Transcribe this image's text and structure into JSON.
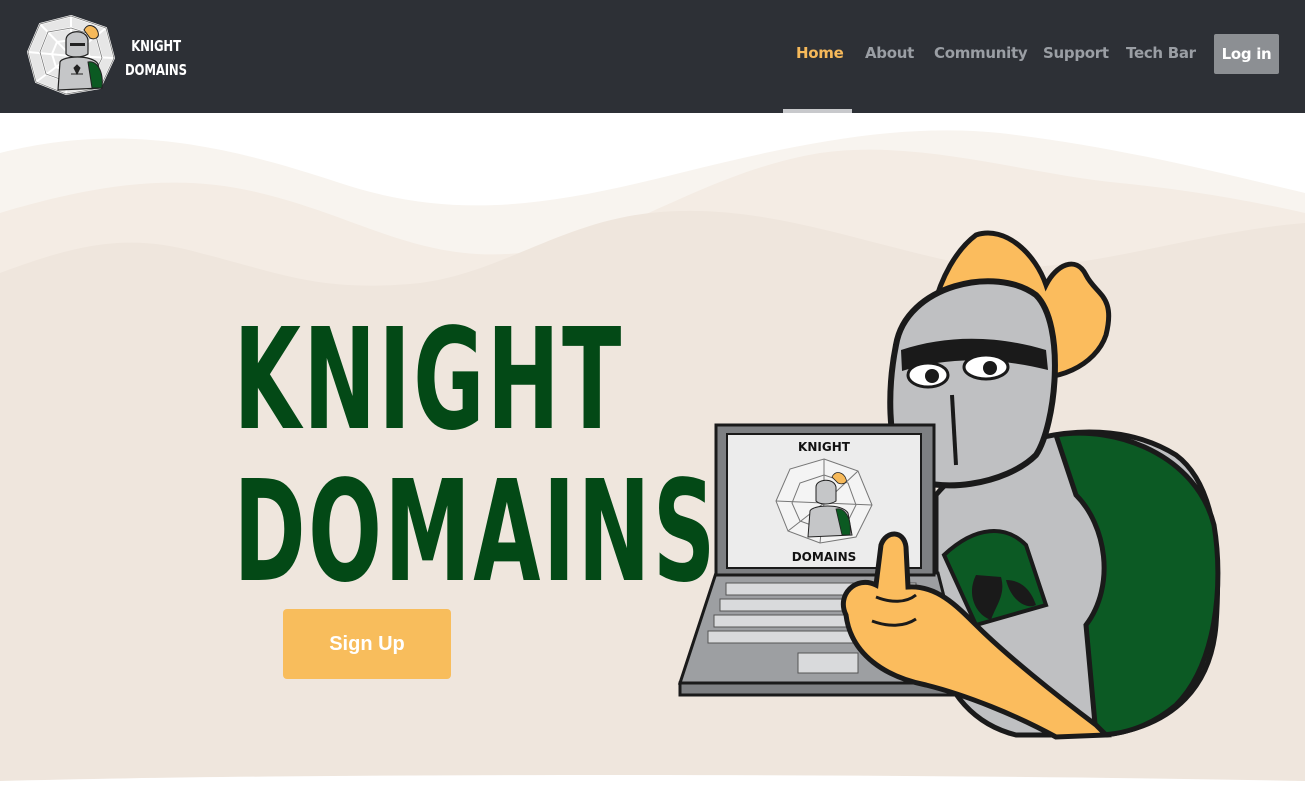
{
  "brand": {
    "line1": "KNIGHT",
    "line2": "DOMAINS",
    "logo_icon": "knight-spiderweb-logo"
  },
  "nav": {
    "items": [
      {
        "label": "Home",
        "active": true
      },
      {
        "label": "About",
        "active": false
      },
      {
        "label": "Community",
        "active": false
      },
      {
        "label": "Support",
        "active": false
      },
      {
        "label": "Tech Bar",
        "active": false
      }
    ],
    "login_label": "Log in"
  },
  "hero": {
    "title_line1": "KNIGHT",
    "title_line2": "DOMAINS",
    "signup_label": "Sign Up",
    "mascot_screen_line1": "KNIGHT",
    "mascot_screen_line2": "DOMAINS",
    "mascot_icon": "knight-mascot-laptop-illustration"
  },
  "colors": {
    "navbar_bg": "#2d3036",
    "nav_active": "#f6b95a",
    "nav_inactive": "#9a9ea4",
    "login_bg": "#8c8f93",
    "hero_bg": "#f0e7de",
    "title_green": "#034916",
    "signup_bg": "#f8bd5c"
  }
}
